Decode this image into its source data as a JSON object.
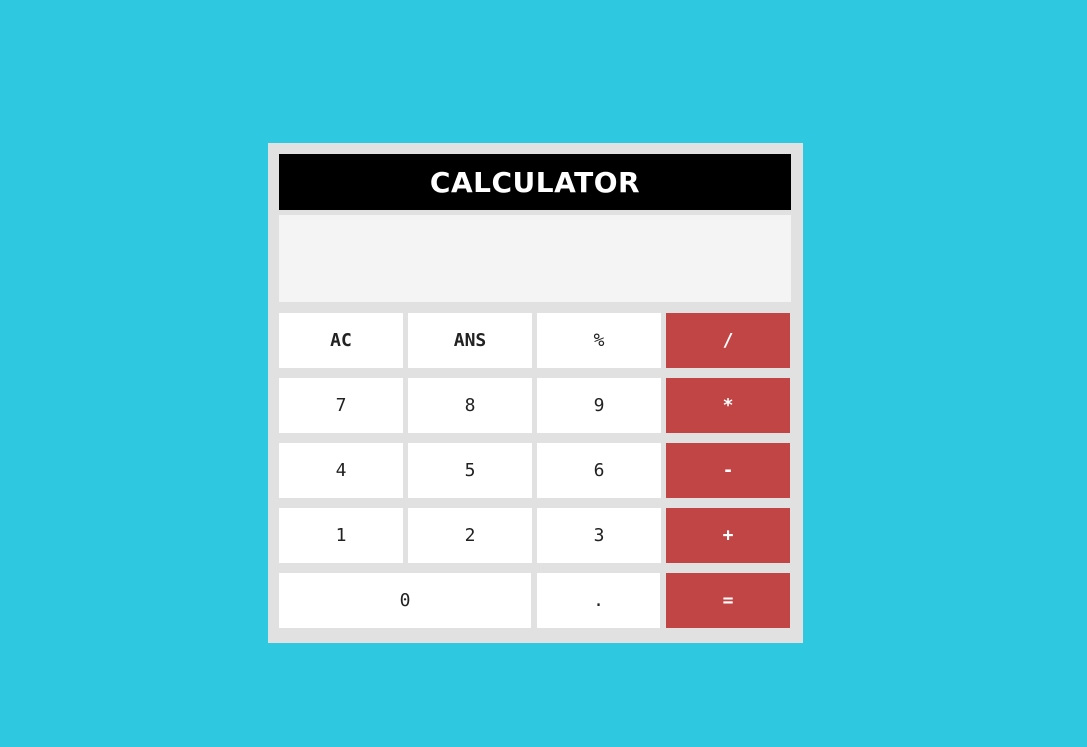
{
  "title": "CALCULATOR",
  "display": {
    "value": ""
  },
  "keys": {
    "ac": "AC",
    "ans": "ANS",
    "percent": "%",
    "divide": "/",
    "seven": "7",
    "eight": "8",
    "nine": "9",
    "multiply": "*",
    "four": "4",
    "five": "5",
    "six": "6",
    "minus": "-",
    "one": "1",
    "two": "2",
    "three": "3",
    "plus": "+",
    "zero": "0",
    "decimal": ".",
    "equals": "="
  },
  "colors": {
    "background": "#2ec9e0",
    "frame": "#e1e1e1",
    "title_bar": "#000000",
    "display": "#f4f4f4",
    "operator": "#c24545",
    "key": "#ffffff"
  }
}
